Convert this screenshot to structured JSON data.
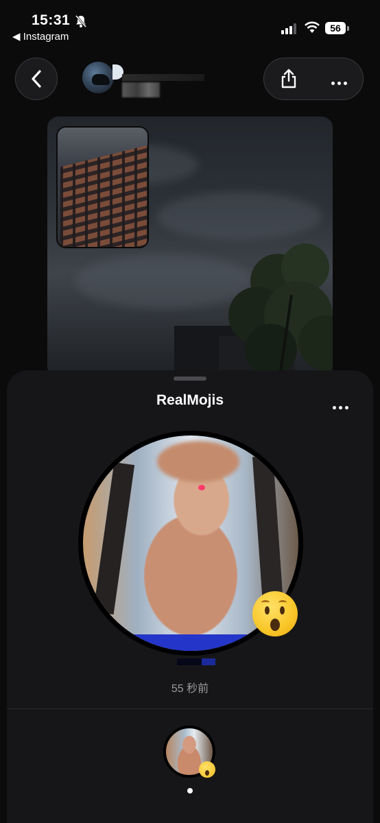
{
  "status_bar": {
    "time": "15:31",
    "back_app": "◀ Instagram",
    "battery": "56",
    "icons": [
      "bell-slash-icon",
      "signal-icon",
      "wifi-icon",
      "battery-icon"
    ]
  },
  "header": {
    "back_icon": "chevron-left-icon",
    "share_icon": "share-icon",
    "more_icon": "ellipsis-icon"
  },
  "sheet": {
    "title": "RealMojis",
    "more_icon": "ellipsis-icon",
    "realmoji_emoji": "😲",
    "time_ago": "55 秒前",
    "page_indicator": {
      "current": 1,
      "total": 1
    }
  },
  "colors": {
    "background": "#0b0b0c",
    "sheet": "#161618",
    "button_bg": "#1b1b1d",
    "secondary_text": "#9b9ba0"
  }
}
